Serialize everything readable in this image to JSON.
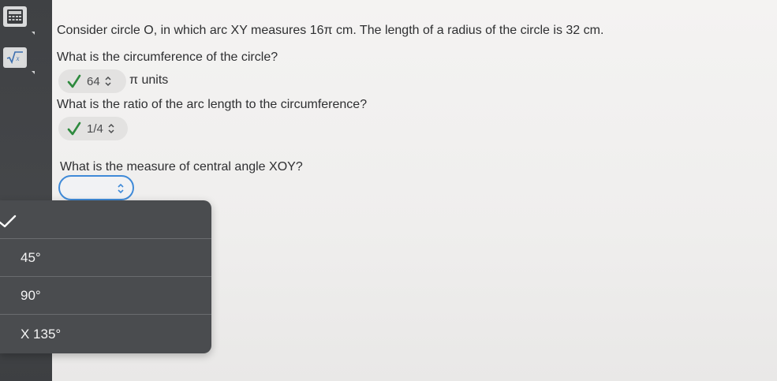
{
  "sidebar": {
    "tools": [
      {
        "icon": "calculator-icon"
      },
      {
        "icon": "square-root-icon",
        "label": "√x"
      }
    ]
  },
  "questions": {
    "intro": "Consider circle O, in which arc XY measures 16π cm. The length of a radius of the circle is 32 cm.",
    "q1": "What is the circumference of the circle?",
    "q1_answer": "64",
    "q1_units": "π units",
    "q2": "What is the ratio of the arc length to the circumference?",
    "q2_answer": "1/4",
    "q3": "What is the measure of central angle XOY?",
    "q3_answer": ""
  },
  "dropdown": {
    "options": [
      {
        "label": "",
        "selected": true
      },
      {
        "label": "45°"
      },
      {
        "label": "90°"
      },
      {
        "label": "X 135°"
      }
    ]
  },
  "colors": {
    "check_green": "#2e8a3e",
    "focus_blue": "#3f8ad8",
    "menu_bg": "#4a4c4f"
  }
}
